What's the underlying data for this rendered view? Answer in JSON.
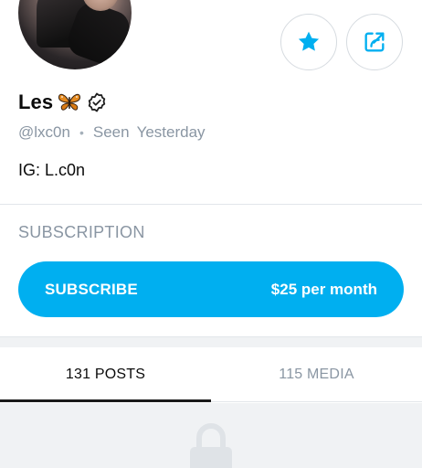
{
  "profile": {
    "name": "Les",
    "emoji_icon": "butterfly-icon",
    "verified_icon": "verified-badge-icon",
    "handle": "@lxc0n",
    "seen_label": "Seen",
    "seen_value": "Yesterday",
    "bio": "IG: L.c0n"
  },
  "actions": {
    "favorite_icon": "star-icon",
    "share_icon": "share-icon"
  },
  "subscription": {
    "heading": "SUBSCRIPTION",
    "button_label": "SUBSCRIBE",
    "price": "$25 per month"
  },
  "tabs": [
    {
      "label": "131 POSTS",
      "active": true
    },
    {
      "label": "115 MEDIA",
      "active": false
    }
  ],
  "content": {
    "locked_icon": "lock-icon"
  },
  "colors": {
    "accent": "#00aff0",
    "muted_text": "#8a96a3",
    "primary_text": "#0b0b0b",
    "divider": "#e2e6ea",
    "band": "#f0f2f4"
  }
}
